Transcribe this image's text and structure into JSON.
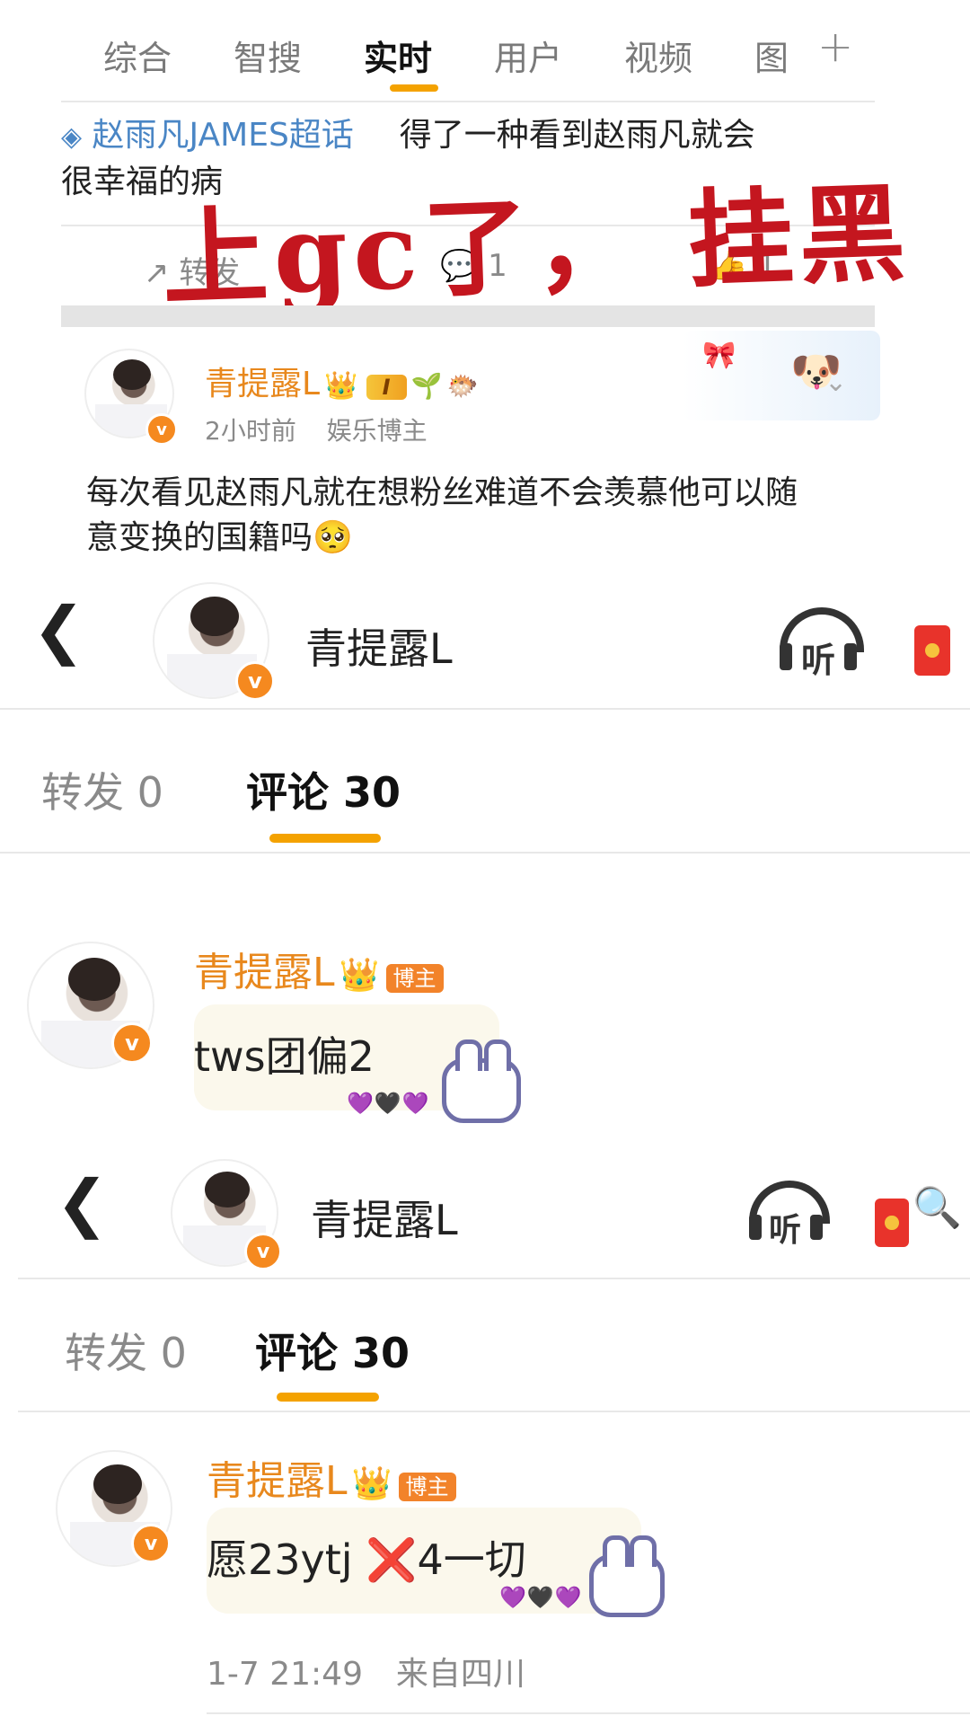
{
  "search_tabs": {
    "items": [
      "综合",
      "智搜",
      "实时",
      "用户",
      "视频",
      "图"
    ],
    "active_index": 2,
    "add_label": "+"
  },
  "post1": {
    "topic": "赵雨凡JAMES超话",
    "text_line1": "得了一种看到赵雨凡就会",
    "text_line2": "很幸福的病",
    "repost_label": "转发",
    "comment_count": "1",
    "like_count": "1"
  },
  "overlay": {
    "annotation": "上gc了， 挂黑"
  },
  "post2": {
    "username": "青提露L",
    "time": "2小时前",
    "role": "娱乐博主",
    "text_line1": "每次看见赵雨凡就在想粉丝难道不会羡慕他可以随",
    "text_line2": "意变换的国籍吗",
    "level_label": "I",
    "emoji": "🥺"
  },
  "profile_header_1": {
    "name": "青提露L",
    "listen_label": "听",
    "repost_tab": "转发 0",
    "comment_tab": "评论 30"
  },
  "comment1": {
    "username": "青提露L",
    "badge": "博主",
    "text": "tws团偏2",
    "hearts": "💜🖤💜"
  },
  "profile_header_2": {
    "name": "青提露L",
    "listen_label": "听",
    "repost_tab": "转发 0",
    "comment_tab": "评论 30"
  },
  "comment2": {
    "username": "青提露L",
    "badge": "博主",
    "text": "愿23ytj ❌4一切",
    "hearts": "💜🖤💜",
    "time": "1-7 21:49",
    "location": "来自四川"
  },
  "colors": {
    "accent": "#f4a200",
    "username": "#e8881d",
    "topic": "#4a86c5",
    "overlay_red": "#c4161f"
  }
}
